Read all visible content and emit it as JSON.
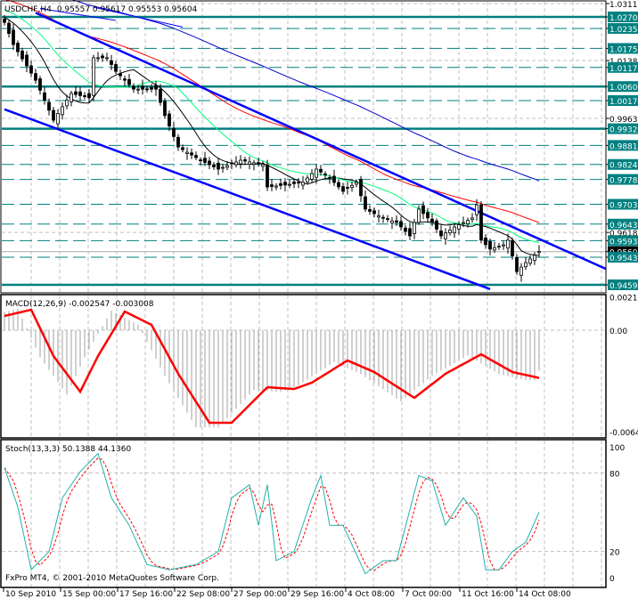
{
  "header": {
    "symbol": "USDCHF,H4",
    "ohlc": "0.95557 0.95617 0.95553 0.95604"
  },
  "macd_header": "MACD(12,26,9) -0.002547 -0.003008",
  "stoch_header": "Stoch(13,3,3) 50.1388 44.1360",
  "copyright": "FxPro MT4, © 2001-2010 MetaQuotes Software Corp.",
  "colors": {
    "teal": "#008080",
    "bull": "#000000",
    "trend": "#0000ff",
    "red": "#ff0000",
    "green": "#00ff7f",
    "gridline": "#c0c0c0"
  },
  "chart_data": [
    {
      "type": "candlestick",
      "title": "USDCHF,H4",
      "ylim": [
        0.9448,
        1.0311
      ],
      "close_keypoints": [
        [
          0,
          1.0254
        ],
        [
          2,
          1.0187
        ],
        [
          7,
          1.0079
        ],
        [
          11,
          0.9958
        ],
        [
          13,
          0.9999
        ],
        [
          15,
          1.0039
        ],
        [
          19,
          1.0026
        ],
        [
          20,
          1.0147
        ],
        [
          23,
          1.0147
        ],
        [
          25,
          1.0106
        ],
        [
          29,
          1.0052
        ],
        [
          34,
          1.0052
        ],
        [
          36,
          0.9972
        ],
        [
          39,
          0.9877
        ],
        [
          44,
          0.9837
        ],
        [
          48,
          0.981
        ],
        [
          53,
          0.9837
        ],
        [
          58,
          0.9824
        ],
        [
          59,
          0.9756
        ],
        [
          63,
          0.9762
        ],
        [
          67,
          0.977
        ],
        [
          70,
          0.981
        ],
        [
          73,
          0.9783
        ],
        [
          76,
          0.9743
        ],
        [
          79,
          0.977
        ],
        [
          81,
          0.9689
        ],
        [
          85,
          0.9662
        ],
        [
          88,
          0.9649
        ],
        [
          91,
          0.9608
        ],
        [
          93,
          0.9689
        ],
        [
          96,
          0.9649
        ],
        [
          98,
          0.9608
        ],
        [
          101,
          0.9635
        ],
        [
          105,
          0.9662
        ],
        [
          106,
          0.9702
        ],
        [
          107,
          0.9595
        ],
        [
          109,
          0.9568
        ],
        [
          112,
          0.9581
        ],
        [
          113,
          0.9595
        ],
        [
          115,
          0.95
        ],
        [
          117,
          0.9527
        ],
        [
          120,
          0.95604
        ]
      ],
      "bars": 121,
      "price_labels": [
        {
          "price": 1.0311,
          "text": "1.03110",
          "kind": "plain"
        },
        {
          "price": 1.02706,
          "text": "1.02706",
          "kind": "solid"
        },
        {
          "price": 1.02357,
          "text": "1.02357",
          "kind": "dashed"
        },
        {
          "price": 1.01752,
          "text": "1.01752",
          "kind": "dashed"
        },
        {
          "price": 1.01385,
          "text": "1.01385",
          "kind": "plain"
        },
        {
          "price": 1.01177,
          "text": "1.01177",
          "kind": "dashed"
        },
        {
          "price": 1.006,
          "text": "1.00600",
          "kind": "solid"
        },
        {
          "price": 1.00174,
          "text": "1.00174",
          "kind": "dashed"
        },
        {
          "price": 0.99635,
          "text": "0.99635",
          "kind": "plain"
        },
        {
          "price": 0.99324,
          "text": "0.99324",
          "kind": "solid"
        },
        {
          "price": 0.98817,
          "text": "0.98817",
          "kind": "dashed"
        },
        {
          "price": 0.98242,
          "text": "0.98242",
          "kind": "dashed"
        },
        {
          "price": 0.97789,
          "text": "0.97789",
          "kind": "dashed"
        },
        {
          "price": 0.97036,
          "text": "0.97036",
          "kind": "dashed"
        },
        {
          "price": 0.96437,
          "text": "0.96437",
          "kind": "dashed"
        },
        {
          "price": 0.96185,
          "text": "0.96185",
          "kind": "plain"
        },
        {
          "price": 0.95935,
          "text": "0.95935",
          "kind": "dashed"
        },
        {
          "price": 0.95604,
          "text": "0.95604",
          "kind": "current"
        },
        {
          "price": 0.95435,
          "text": "0.95435",
          "kind": "dashed"
        },
        {
          "price": 0.94599,
          "text": "0.94599",
          "kind": "solid"
        }
      ],
      "trendlines": [
        {
          "from": [
            7,
            1.0283
          ],
          "to": [
            135,
            0.9508
          ],
          "width": 2.5
        },
        {
          "from": [
            0,
            0.9991
          ],
          "to": [
            109,
            0.9447
          ],
          "width": 2.5
        },
        {
          "from": [
            8,
            1.0296
          ],
          "to": [
            25,
            1.026
          ],
          "width": 1
        },
        {
          "from": [
            20,
            1.03
          ],
          "to": [
            40,
            1.024
          ],
          "width": 1
        }
      ],
      "moving_averages": [
        {
          "name": "MA fast",
          "period": 10,
          "color": "#000000"
        },
        {
          "name": "MA mid",
          "period": 20,
          "color": "#00ff7f"
        },
        {
          "name": "MA slow",
          "period": 50,
          "color": "#ff0000"
        },
        {
          "name": "MA long",
          "period": 100,
          "color": "#0000cd"
        }
      ],
      "x_tick_labels": [
        "10 Sep 2010",
        "15 Sep 00:00",
        "17 Sep 16:00",
        "22 Sep 08:00",
        "27 Sep 00:00",
        "29 Sep 16:00",
        "4 Oct 08:00",
        "7 Oct 00:00",
        "11 Oct 16:00",
        "14 Oct 08:00"
      ]
    },
    {
      "type": "line+bar",
      "title": "MACD(12,26,9)",
      "ylim": [
        -0.0064,
        0.00211
      ],
      "y_tick_labels": [
        "0.00211",
        "0.00",
        "-0.0064"
      ],
      "signal_keypoints": [
        [
          0,
          0.0009
        ],
        [
          6,
          0.00129
        ],
        [
          11,
          -0.00163
        ],
        [
          17,
          -0.00388
        ],
        [
          21,
          -0.00163
        ],
        [
          27,
          0.00118
        ],
        [
          33,
          0.00034
        ],
        [
          39,
          -0.00275
        ],
        [
          46,
          -0.00584
        ],
        [
          51,
          -0.00584
        ],
        [
          59,
          -0.0036
        ],
        [
          65,
          -0.00371
        ],
        [
          69,
          -0.00331
        ],
        [
          77,
          -0.00191
        ],
        [
          83,
          -0.00264
        ],
        [
          92,
          -0.00427
        ],
        [
          99,
          -0.00275
        ],
        [
          107,
          -0.00152
        ],
        [
          114,
          -0.00264
        ],
        [
          120,
          -0.00301
        ]
      ],
      "main_last": -0.002547,
      "signal_last": -0.003008
    },
    {
      "type": "line",
      "title": "Stoch(13,3,3)",
      "ylim": [
        0,
        100
      ],
      "y_tick_labels": [
        "100",
        "80",
        "20",
        "0"
      ],
      "main_keypoints": [
        [
          0,
          84
        ],
        [
          3,
          54
        ],
        [
          6,
          6
        ],
        [
          10,
          20
        ],
        [
          13,
          61
        ],
        [
          17,
          81
        ],
        [
          21,
          95
        ],
        [
          24,
          61
        ],
        [
          28,
          40
        ],
        [
          32,
          10
        ],
        [
          37,
          6
        ],
        [
          43,
          10
        ],
        [
          48,
          20
        ],
        [
          51,
          61
        ],
        [
          55,
          71
        ],
        [
          57,
          40
        ],
        [
          59,
          71
        ],
        [
          61,
          13
        ],
        [
          65,
          20
        ],
        [
          69,
          61
        ],
        [
          71,
          78
        ],
        [
          73,
          40
        ],
        [
          76,
          40
        ],
        [
          81,
          3
        ],
        [
          85,
          13
        ],
        [
          88,
          13
        ],
        [
          93,
          78
        ],
        [
          96,
          74
        ],
        [
          99,
          40
        ],
        [
          103,
          61
        ],
        [
          106,
          47
        ],
        [
          108,
          6
        ],
        [
          111,
          6
        ],
        [
          114,
          20
        ],
        [
          117,
          27
        ],
        [
          120,
          50.1388
        ]
      ],
      "signal_last": 44.136
    }
  ]
}
